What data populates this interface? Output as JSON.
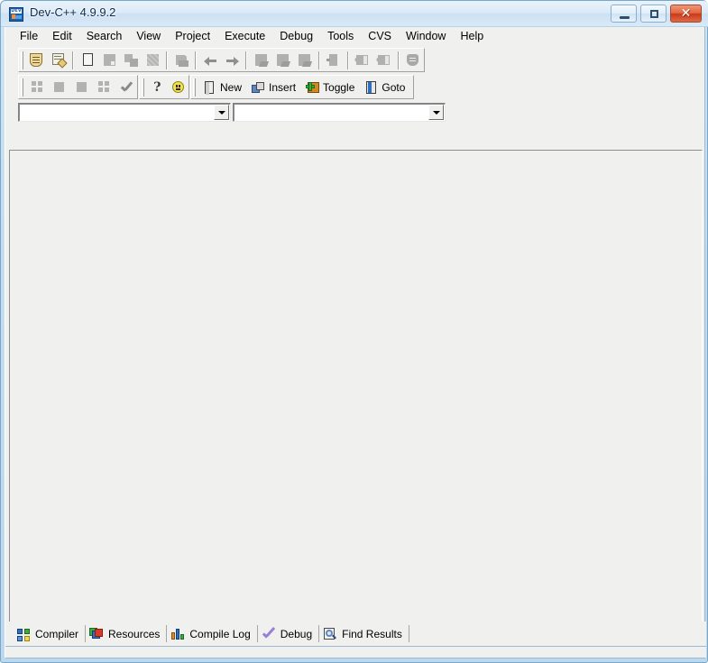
{
  "window": {
    "title": "Dev-C++ 4.9.9.2",
    "icon": "dev-cpp-app-icon",
    "controls": {
      "minimize": "minimize-button",
      "maximize": "maximize-button",
      "close": "close-button",
      "close_glyph": "✕"
    },
    "accent_titlebar": "#dceaf7",
    "accent_close": "#c9391b",
    "frame_color": "#bcd8ee",
    "client_bg": "#f0f0ee"
  },
  "menu": {
    "items": [
      {
        "label": "File"
      },
      {
        "label": "Edit"
      },
      {
        "label": "Search"
      },
      {
        "label": "View"
      },
      {
        "label": "Project"
      },
      {
        "label": "Execute"
      },
      {
        "label": "Debug"
      },
      {
        "label": "Tools"
      },
      {
        "label": "CVS"
      },
      {
        "label": "Window"
      },
      {
        "label": "Help"
      }
    ]
  },
  "toolbar_main": {
    "groups": [
      {
        "name": "file-group",
        "buttons": [
          {
            "icon": "new-source-file-icon",
            "enabled": true
          },
          {
            "icon": "open-project-icon",
            "enabled": true
          }
        ]
      },
      {
        "name": "save-group",
        "buttons": [
          {
            "icon": "save-file-icon",
            "enabled": false
          },
          {
            "icon": "save-all-icon",
            "enabled": false
          },
          {
            "icon": "close-file-icon",
            "enabled": false
          },
          {
            "icon": "print-icon",
            "enabled": false
          },
          {
            "icon": "properties-icon",
            "enabled": false
          }
        ]
      },
      {
        "name": "undo-group",
        "buttons": [
          {
            "icon": "undo-icon",
            "enabled": false
          },
          {
            "icon": "redo-icon",
            "enabled": false
          }
        ]
      },
      {
        "name": "compile-group",
        "buttons": [
          {
            "icon": "compile-icon",
            "enabled": false
          },
          {
            "icon": "run-icon",
            "enabled": false
          },
          {
            "icon": "compile-and-run-icon",
            "enabled": false
          },
          {
            "icon": "rebuild-all-icon",
            "enabled": false
          }
        ]
      },
      {
        "name": "navigate-group",
        "buttons": [
          {
            "icon": "go-back-icon",
            "enabled": false
          },
          {
            "icon": "go-forward-icon",
            "enabled": false
          },
          {
            "icon": "profile-analysis-icon",
            "enabled": false
          }
        ]
      }
    ]
  },
  "toolbar_secondary": {
    "groups": [
      {
        "name": "debug-group",
        "buttons": [
          {
            "icon": "add-watch-icon",
            "enabled": false
          },
          {
            "icon": "stop-execution-icon",
            "enabled": false
          },
          {
            "icon": "pause-icon",
            "enabled": false
          },
          {
            "icon": "step-over-icon",
            "enabled": false
          },
          {
            "icon": "validate-icon",
            "enabled": false
          }
        ]
      },
      {
        "name": "help-group",
        "buttons": [
          {
            "icon": "help-question-icon",
            "enabled": true
          },
          {
            "icon": "about-smiley-icon",
            "enabled": true
          }
        ]
      },
      {
        "name": "bookmark-group",
        "buttons": [
          {
            "icon": "new-class-icon",
            "label": "New",
            "enabled": true
          },
          {
            "icon": "insert-icon",
            "label": "Insert",
            "enabled": true
          },
          {
            "icon": "toggle-icon",
            "label": "Toggle",
            "enabled": true
          },
          {
            "icon": "goto-icon",
            "label": "Goto",
            "enabled": true
          }
        ]
      }
    ]
  },
  "combos": {
    "class_browser": {
      "value": "",
      "placeholder": "",
      "arrow": "chevron-down-icon"
    },
    "member_browser": {
      "value": "",
      "placeholder": "",
      "arrow": "chevron-down-icon"
    }
  },
  "editor": {
    "content": "",
    "background": "#f0f0ee"
  },
  "bottom_tabs": {
    "items": [
      {
        "label": "Compiler",
        "icon": "compiler-icon"
      },
      {
        "label": "Resources",
        "icon": "resources-icon"
      },
      {
        "label": "Compile Log",
        "icon": "compile-log-icon"
      },
      {
        "label": "Debug",
        "icon": "debug-check-icon"
      },
      {
        "label": "Find Results",
        "icon": "find-results-icon"
      }
    ]
  }
}
